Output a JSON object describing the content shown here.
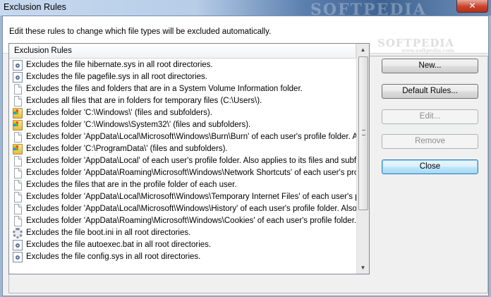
{
  "window": {
    "title": "Exclusion Rules",
    "close_label": "✕",
    "watermark": "SOFTPEDIA"
  },
  "dialog": {
    "instruction": "Edit these rules to change which file types will be excluded automatically.",
    "logo_watermark": "SOFTPEDIA",
    "logo_watermark_sub": "www.softpedia.com"
  },
  "list": {
    "column_header": "Exclusion Rules",
    "rows": [
      {
        "icon": "system-file-icon",
        "text": "Excludes the file hibernate.sys in all root directories."
      },
      {
        "icon": "system-file-icon",
        "text": "Excludes the file pagefile.sys in all root directories."
      },
      {
        "icon": "document-icon",
        "text": "Excludes the files and folders that are in a System Volume Information folder."
      },
      {
        "icon": "document-icon",
        "text": "Excludes all files that are in folders for temporary files (C:\\Users\\)."
      },
      {
        "icon": "windows-folder-icon",
        "text": "Excludes folder 'C:\\Windows\\' (files and subfolders)."
      },
      {
        "icon": "windows-folder-icon",
        "text": "Excludes folder 'C:\\Windows\\System32\\' (files and subfolders)."
      },
      {
        "icon": "document-icon",
        "text": "Excludes folder 'AppData\\Local\\Microsoft\\Windows\\Burn\\Burn' of each user's profile folder. Als..."
      },
      {
        "icon": "windows-folder-icon",
        "text": "Excludes folder 'C:\\ProgramData\\' (files and subfolders)."
      },
      {
        "icon": "document-icon",
        "text": "Excludes folder 'AppData\\Local' of each user's profile folder. Also applies to its files and subfolders."
      },
      {
        "icon": "document-icon",
        "text": "Excludes folder 'AppData\\Roaming\\Microsoft\\Windows\\Network Shortcuts' of each user's profile..."
      },
      {
        "icon": "document-icon",
        "text": "Excludes the files that are in the profile folder of each user."
      },
      {
        "icon": "document-icon",
        "text": "Excludes folder 'AppData\\Local\\Microsoft\\Windows\\Temporary Internet Files' of each user's pro..."
      },
      {
        "icon": "document-icon",
        "text": "Excludes folder 'AppData\\Local\\Microsoft\\Windows\\History' of each user's profile folder. Also a..."
      },
      {
        "icon": "document-icon",
        "text": "Excludes folder 'AppData\\Roaming\\Microsoft\\Windows\\Cookies' of each user's profile folder. Al..."
      },
      {
        "icon": "settings-file-icon",
        "text": "Excludes the file boot.ini in all root directories."
      },
      {
        "icon": "system-file-icon",
        "text": "Excludes the file autoexec.bat in all root directories."
      },
      {
        "icon": "system-file-icon",
        "text": "Excludes the file config.sys in all root directories."
      }
    ]
  },
  "buttons": {
    "new": "New...",
    "default_rules": "Default Rules...",
    "edit": "Edit...",
    "remove": "Remove",
    "close": "Close"
  }
}
